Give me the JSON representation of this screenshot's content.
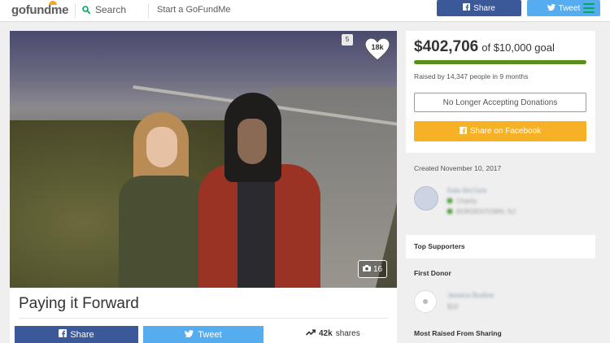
{
  "header": {
    "logo_text_1": "go",
    "logo_text_2": "fund",
    "logo_text_3": "me",
    "search_label": "Search",
    "start_label": "Start a GoFundMe",
    "share_label": "Share",
    "tweet_label": "Tweet"
  },
  "campaign": {
    "title": "Paying it Forward",
    "hearts": "18k",
    "photo_count": "16",
    "sign_text": "5",
    "share_label": "Share",
    "tweet_label": "Tweet",
    "shares_count": "42k",
    "shares_label": "shares"
  },
  "donation": {
    "raised": "$402,706",
    "goal_text": "of $10,000 goal",
    "progress_fraction": 1.0,
    "raised_by": "Raised by 14,347 people in 9 months",
    "status_button": "No Longer Accepting Donations",
    "facebook_button": "Share on Facebook"
  },
  "details": {
    "created": "Created November 10, 2017",
    "organizer_name": "Kate McClure",
    "organizer_category": "Charity",
    "organizer_location": "BORDENTOWN, NJ"
  },
  "supporters": {
    "heading": "Top Supporters",
    "first_donor_heading": "First Donor",
    "first_donor_name": "Jessica Bodine",
    "first_donor_amount": "$10",
    "most_raised_heading": "Most Raised From Sharing"
  },
  "colors": {
    "facebook": "#3b5998",
    "twitter": "#55acee",
    "accent_green": "#02a95c",
    "progress_green": "#5a8f1c",
    "share_yellow": "#f6b127"
  }
}
